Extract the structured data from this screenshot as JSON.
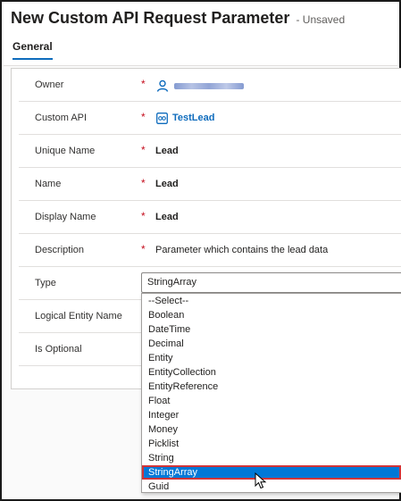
{
  "header": {
    "title": "New Custom API Request Parameter",
    "status": "- Unsaved"
  },
  "tabs": [
    {
      "label": "General",
      "active": true
    }
  ],
  "fields": [
    {
      "label": "Owner",
      "required": "*",
      "value": "",
      "icon": "user-icon"
    },
    {
      "label": "Custom API",
      "required": "*",
      "value": "TestLead",
      "icon": "entity-link-icon"
    },
    {
      "label": "Unique Name",
      "required": "*",
      "value": "Lead"
    },
    {
      "label": "Name",
      "required": "*",
      "value": "Lead"
    },
    {
      "label": "Display Name",
      "required": "*",
      "value": "Lead"
    },
    {
      "label": "Description",
      "required": "*",
      "value": "Parameter which contains the lead data"
    },
    {
      "label": "Type",
      "required": "*",
      "value": "StringArray"
    },
    {
      "label": "Logical Entity Name",
      "required": "",
      "value": ""
    },
    {
      "label": "Is Optional",
      "required": "*",
      "value": ""
    }
  ],
  "type_dropdown": {
    "selected": "StringArray",
    "options": [
      "--Select--",
      "Boolean",
      "DateTime",
      "Decimal",
      "Entity",
      "EntityCollection",
      "EntityReference",
      "Float",
      "Integer",
      "Money",
      "Picklist",
      "String",
      "StringArray",
      "Guid"
    ],
    "highlighted_index": 12
  },
  "colors": {
    "accent": "#0f6cbd",
    "required": "#c50f1f",
    "selection": "#0078d7",
    "selection_outline": "#d13438"
  }
}
